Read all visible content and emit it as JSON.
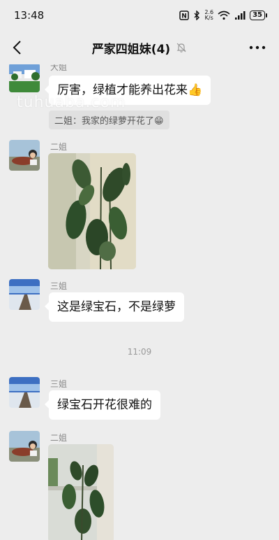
{
  "status": {
    "time": "13:48",
    "net_speed_top": "2.6",
    "net_speed_bottom": "K/s",
    "battery": "35"
  },
  "nav": {
    "title": "严家四姐妹(4)"
  },
  "watermark": "tuhuaba.com",
  "messages": {
    "m1": {
      "sender": "大姐",
      "text": "厉害，绿植才能养出花来",
      "emoji": "👍"
    },
    "m1_quote": {
      "text": "二姐：我家的绿萝开花了",
      "emoji": "😁"
    },
    "m2": {
      "sender": "二姐"
    },
    "m3": {
      "sender": "三姐",
      "text": "这是绿宝石，不是绿萝"
    },
    "time_divider": "11:09",
    "m4": {
      "sender": "三姐",
      "text": "绿宝石开花很难的"
    },
    "m5": {
      "sender": "二姐"
    }
  },
  "colors": {
    "background": "#ededed",
    "bubble": "#ffffff",
    "quote_bg": "#e0e0e0"
  }
}
